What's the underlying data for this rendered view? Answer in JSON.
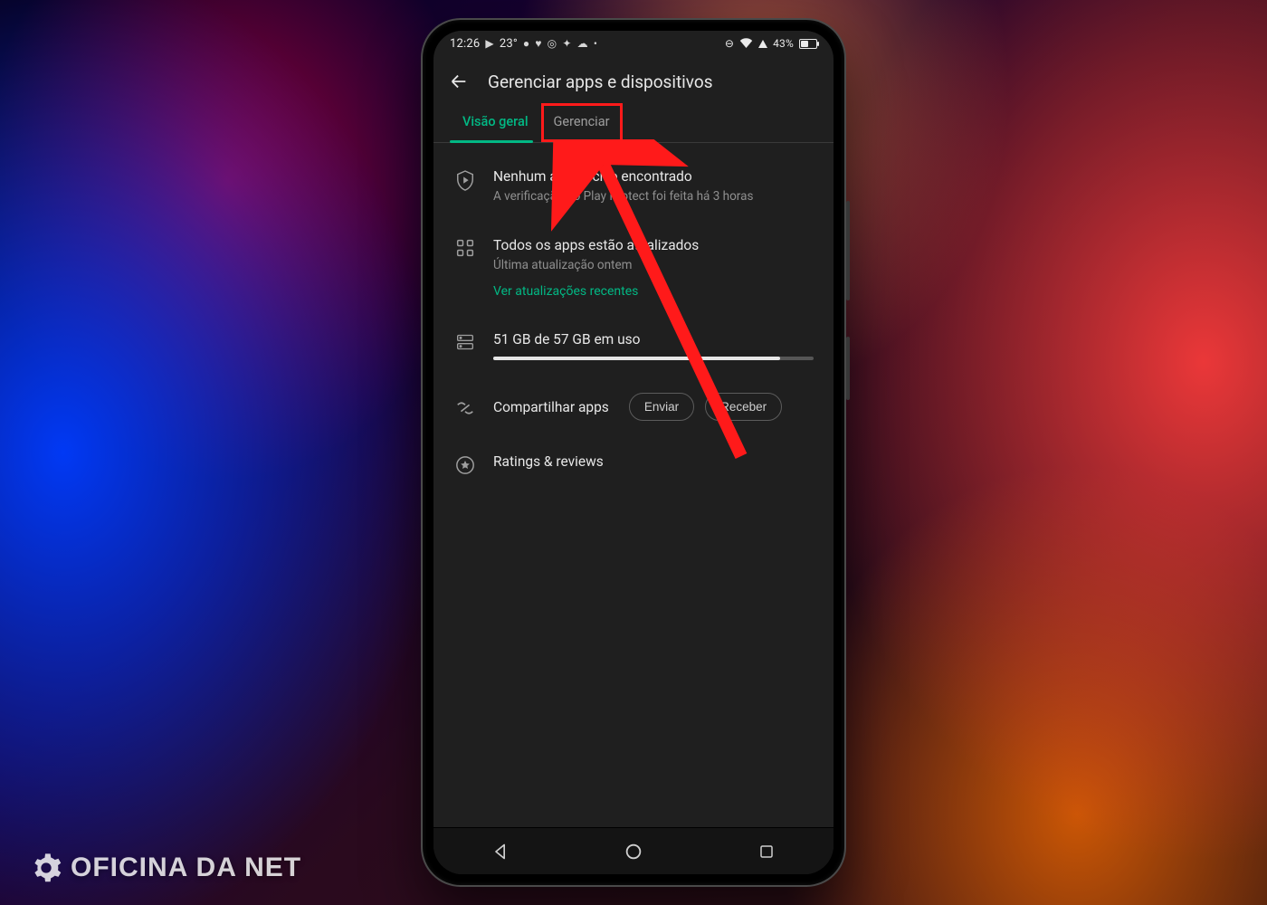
{
  "status": {
    "time": "12:26",
    "temp": "23°",
    "battery_pct": "43%",
    "battery_fill": 43
  },
  "header": {
    "title": "Gerenciar apps e dispositivos"
  },
  "tabs": {
    "overview": "Visão geral",
    "manage": "Gerenciar"
  },
  "protect": {
    "title": "Nenhum app nocivo encontrado",
    "subtitle": "A verificação do Play Protect foi feita há 3 horas"
  },
  "updates": {
    "title": "Todos os apps estão atualizados",
    "subtitle": "Última atualização ontem",
    "link": "Ver atualizações recentes"
  },
  "storage": {
    "label": "51 GB de 57 GB em uso",
    "used": 51,
    "total": 57
  },
  "share": {
    "title": "Compartilhar apps",
    "send": "Enviar",
    "receive": "Receber"
  },
  "ratings": {
    "title": "Ratings & reviews"
  },
  "watermark": "OFICINA DA NET",
  "colors": {
    "accent": "#02b884",
    "annotation": "#ff1a1a"
  }
}
